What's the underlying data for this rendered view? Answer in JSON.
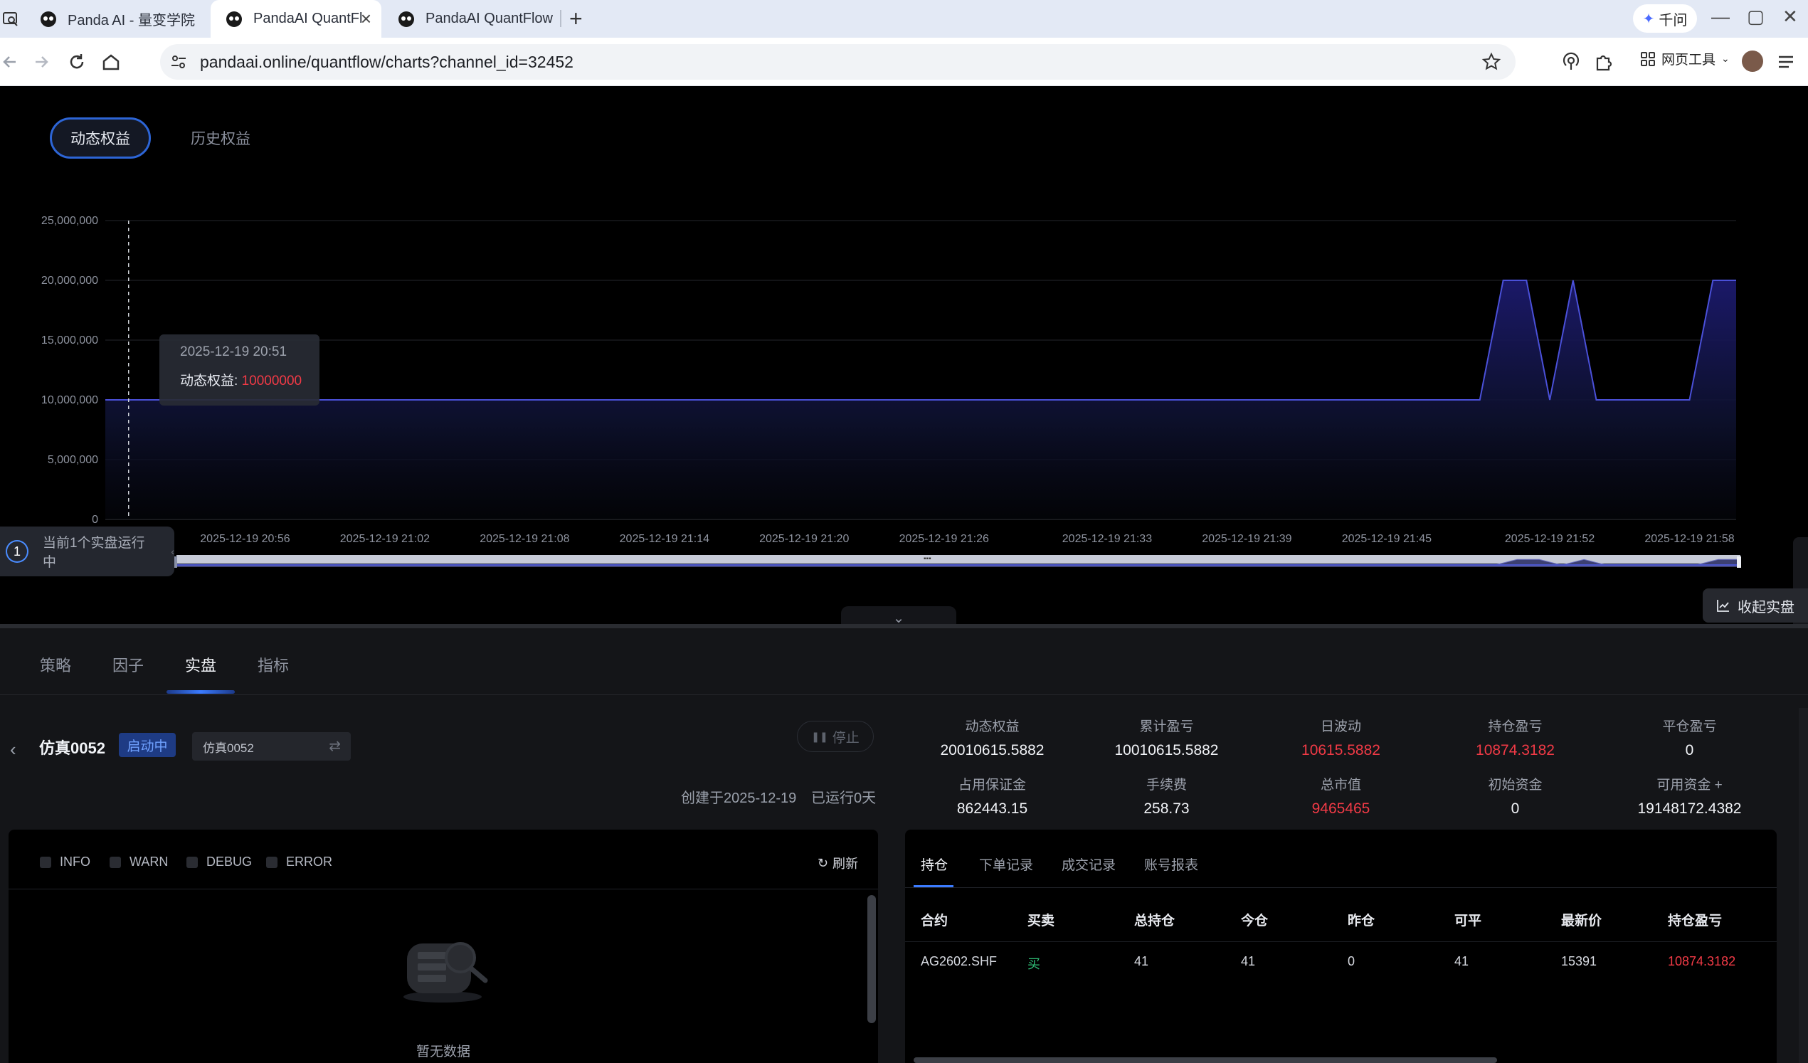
{
  "browser": {
    "tabs": [
      {
        "title": "Panda AI - 量变学院",
        "active": false
      },
      {
        "title": "PandaAI QuantFl",
        "active": true
      },
      {
        "title": "PandaAI QuantFlow",
        "active": false
      }
    ],
    "new_tab": "+",
    "assistant": "千问",
    "window_controls": {
      "minimize": "—",
      "restore": "▢",
      "close": "✕"
    },
    "url": "pandaai.online/quantflow/charts?channel_id=32452",
    "web_tools": "网页工具"
  },
  "equity_tabs": {
    "dynamic": "动态权益",
    "history": "历史权益"
  },
  "chart_data": {
    "type": "area",
    "title": "",
    "y_ticks": [
      "25,000,000",
      "20,000,000",
      "15,000,000",
      "10,000,000",
      "5,000,000",
      "0"
    ],
    "ylim": [
      0,
      25000000
    ],
    "x_ticks": [
      "2025-12-19 20:56",
      "2025-12-19 21:02",
      "2025-12-19 21:08",
      "2025-12-19 21:14",
      "2025-12-19 21:20",
      "2025-12-19 21:26",
      "2025-12-19 21:33",
      "2025-12-19 21:39",
      "2025-12-19 21:45",
      "2025-12-19 21:52",
      "2025-12-19 21:58"
    ],
    "xlim": [
      "2025-12-19 20:50",
      "2025-12-19 22:00"
    ],
    "series": [
      {
        "points": [
          [
            "2025-12-19 20:50",
            10000000
          ],
          [
            "2025-12-19 21:49",
            10000000
          ],
          [
            "2025-12-19 21:50",
            20000000
          ],
          [
            "2025-12-19 21:51",
            20000000
          ],
          [
            "2025-12-19 21:52",
            10000000
          ],
          [
            "2025-12-19 21:53",
            20000000
          ],
          [
            "2025-12-19 21:54",
            10000000
          ],
          [
            "2025-12-19 21:58",
            10000000
          ],
          [
            "2025-12-19 21:59",
            20000000
          ],
          [
            "2025-12-19 22:00",
            20000000
          ]
        ]
      }
    ],
    "grid": true,
    "line_color": "#4a50d8",
    "cursor_time": "2025-12-19 20:51"
  },
  "tooltip": {
    "time": "2025-12-19 20:51",
    "label": "动态权益: ",
    "value": "10000000"
  },
  "running_badge": {
    "count": "1",
    "text": "当前1个实盘运行中"
  },
  "collapse_live": "收起实盘",
  "sub_tabs": [
    "策略",
    "因子",
    "实盘",
    "指标"
  ],
  "sim": {
    "title": "仿真0052",
    "status": "启动中",
    "select_value": "仿真0052",
    "stop_label": "停止",
    "created": "创建于2025-12-19",
    "runtime": "已运行0天"
  },
  "metrics": [
    {
      "label": "动态权益",
      "value": "20010615.5882",
      "color": "#f2f4f8"
    },
    {
      "label": "累计盈亏",
      "value": "10010615.5882",
      "color": "#f2f4f8"
    },
    {
      "label": "日波动",
      "value": "10615.5882",
      "color": "#f23a46"
    },
    {
      "label": "持仓盈亏",
      "value": "10874.3182",
      "color": "#f23a46"
    },
    {
      "label": "平仓盈亏",
      "value": "0",
      "color": "#f2f4f8"
    },
    {
      "label": "占用保证金",
      "value": "862443.15",
      "color": "#f2f4f8"
    },
    {
      "label": "手续费",
      "value": "258.73",
      "color": "#f2f4f8"
    },
    {
      "label": "总市值",
      "value": "9465465",
      "color": "#f23a46"
    },
    {
      "label": "初始资金",
      "value": "0",
      "color": "#f2f4f8"
    },
    {
      "label": "可用资金 +",
      "value": "19148172.4382",
      "color": "#f2f4f8"
    }
  ],
  "logs": {
    "levels": [
      "INFO",
      "WARN",
      "DEBUG",
      "ERROR"
    ],
    "refresh": "刷新",
    "empty": "暂无数据"
  },
  "positions": {
    "tabs": [
      "持仓",
      "下单记录",
      "成交记录",
      "账号报表"
    ],
    "columns": [
      "合约",
      "买卖",
      "总持仓",
      "今仓",
      "昨仓",
      "可平",
      "最新价",
      "持仓盈亏"
    ],
    "rows": [
      {
        "contract": "AG2602.SHF",
        "side": "买",
        "total": "41",
        "today": "41",
        "yesterday": "0",
        "closable": "41",
        "last": "15391",
        "pnl": "10874.3182"
      }
    ]
  }
}
